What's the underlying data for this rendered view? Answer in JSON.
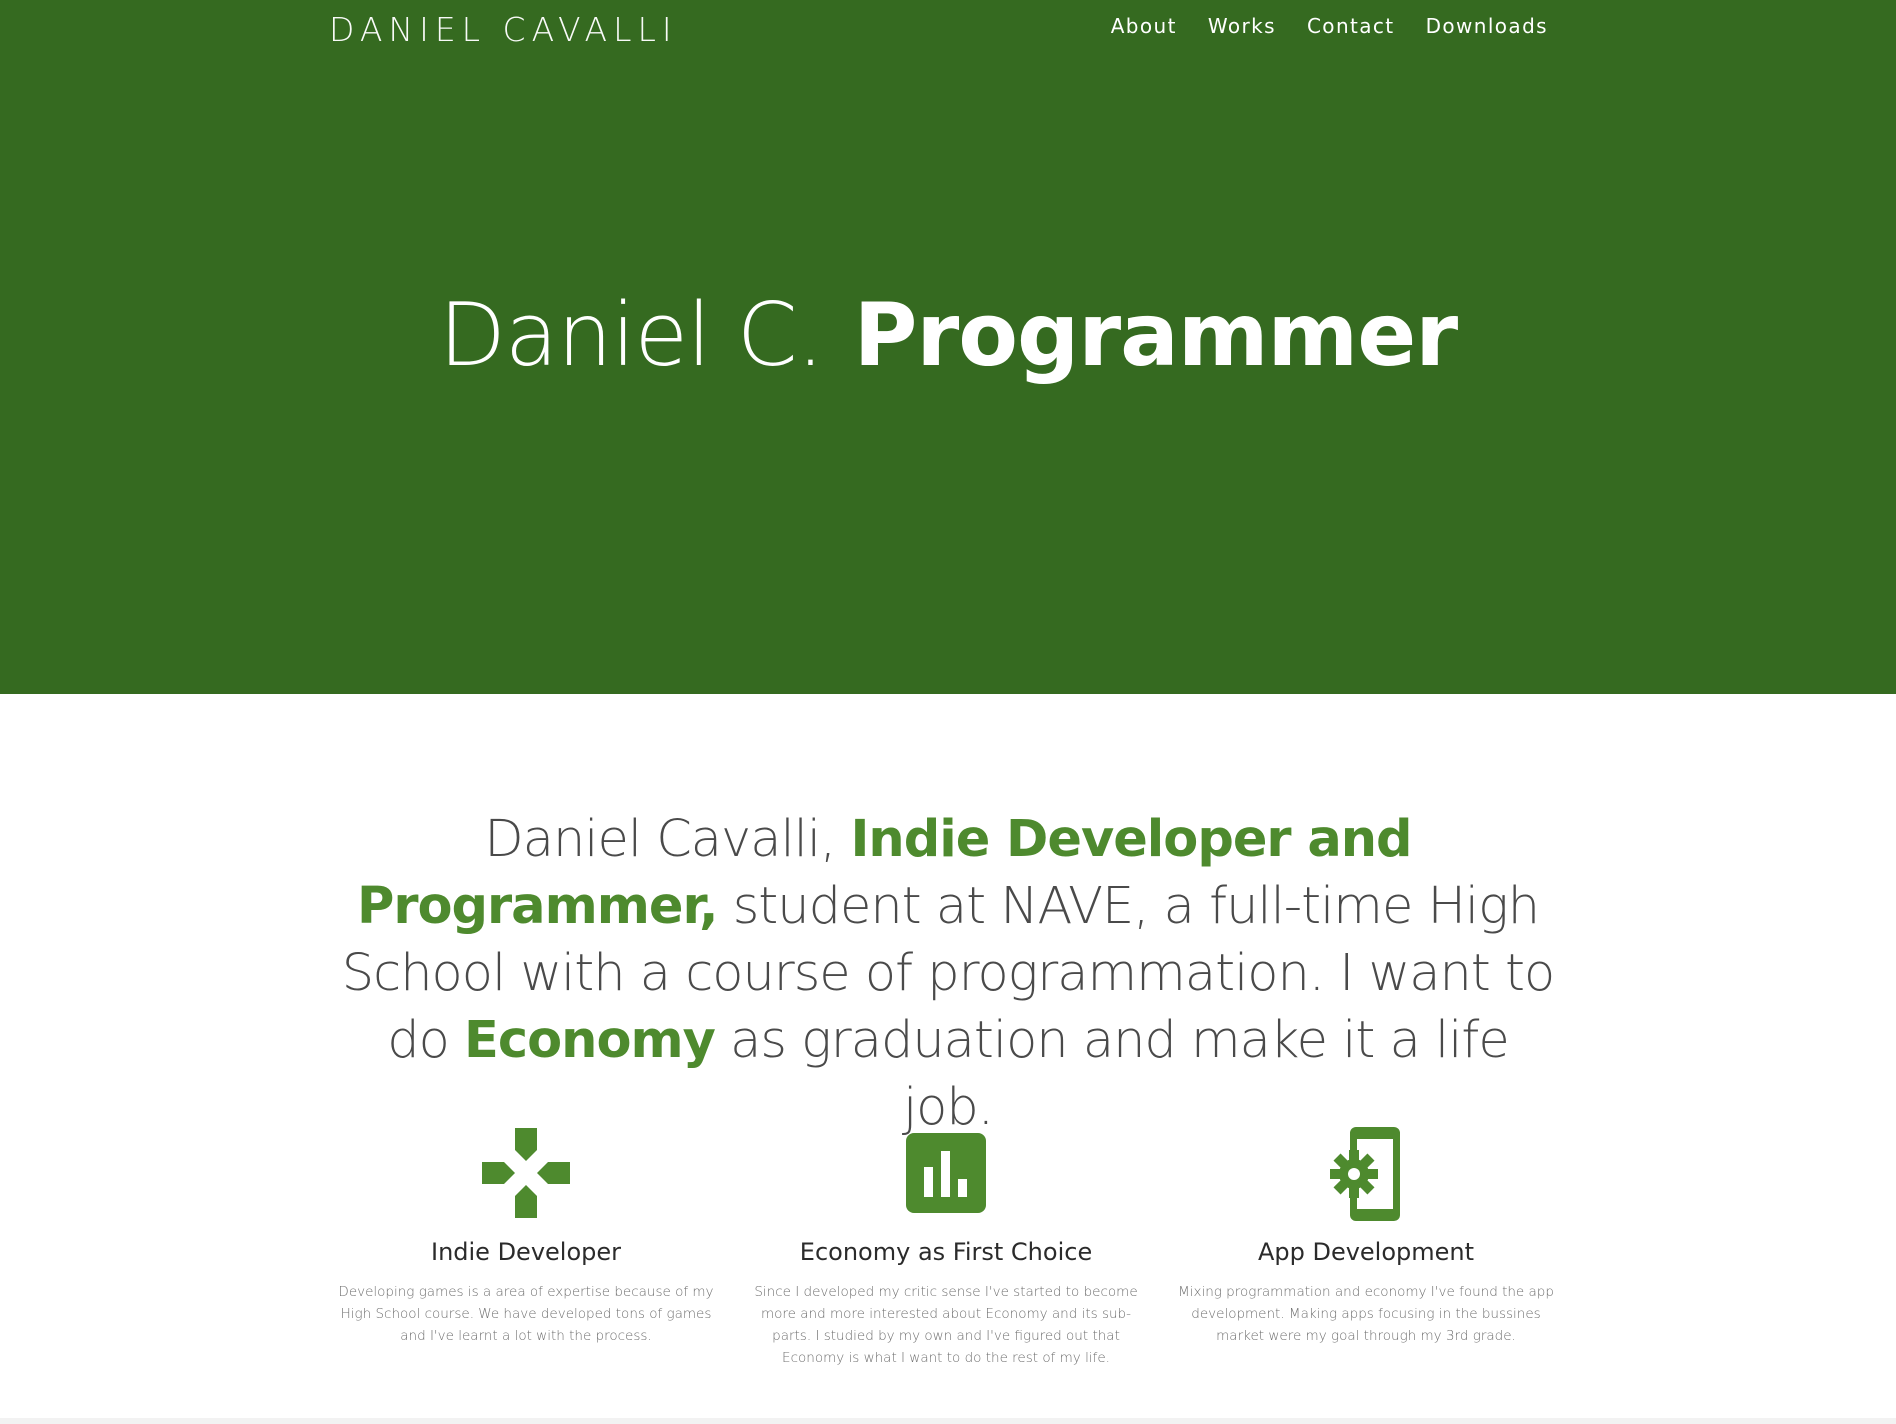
{
  "brand": "DANIEL CAVALLI",
  "nav": {
    "items": [
      {
        "label": "About"
      },
      {
        "label": "Works"
      },
      {
        "label": "Contact"
      },
      {
        "label": "Downloads"
      }
    ]
  },
  "hero": {
    "title_light": "Daniel C.",
    "title_bold": "Programmer"
  },
  "intro": {
    "part1": "Daniel Cavalli,",
    "highlight1": "Indie Developer and Programmer,",
    "part2": "student at NAVE, a full-time High School with a course of programmation. I want to do",
    "highlight2": "Economy",
    "part3": "as graduation and make it a life job."
  },
  "features": [
    {
      "icon": "gamepad-icon",
      "title": "Indie Developer",
      "text": "Developing games is a area of expertise because of my High School course. We have developed tons of games and I've learnt a lot with the process."
    },
    {
      "icon": "bar-chart-icon",
      "title": "Economy as First Choice",
      "text": "Since I developed my critic sense I've started to become more and more interested about Economy and its sub-parts. I studied by my own and I've figured out that Economy is what I want to do the rest of my life."
    },
    {
      "icon": "phone-settings-icon",
      "title": "App Development",
      "text": "Mixing programmation and economy I've found the app development. Making apps focusing in the bussines market were my goal through my 3rd grade."
    }
  ],
  "colors": {
    "hero_bg": "#356a20",
    "accent": "#4e8a2e",
    "text_dark": "#4a4a4a"
  }
}
